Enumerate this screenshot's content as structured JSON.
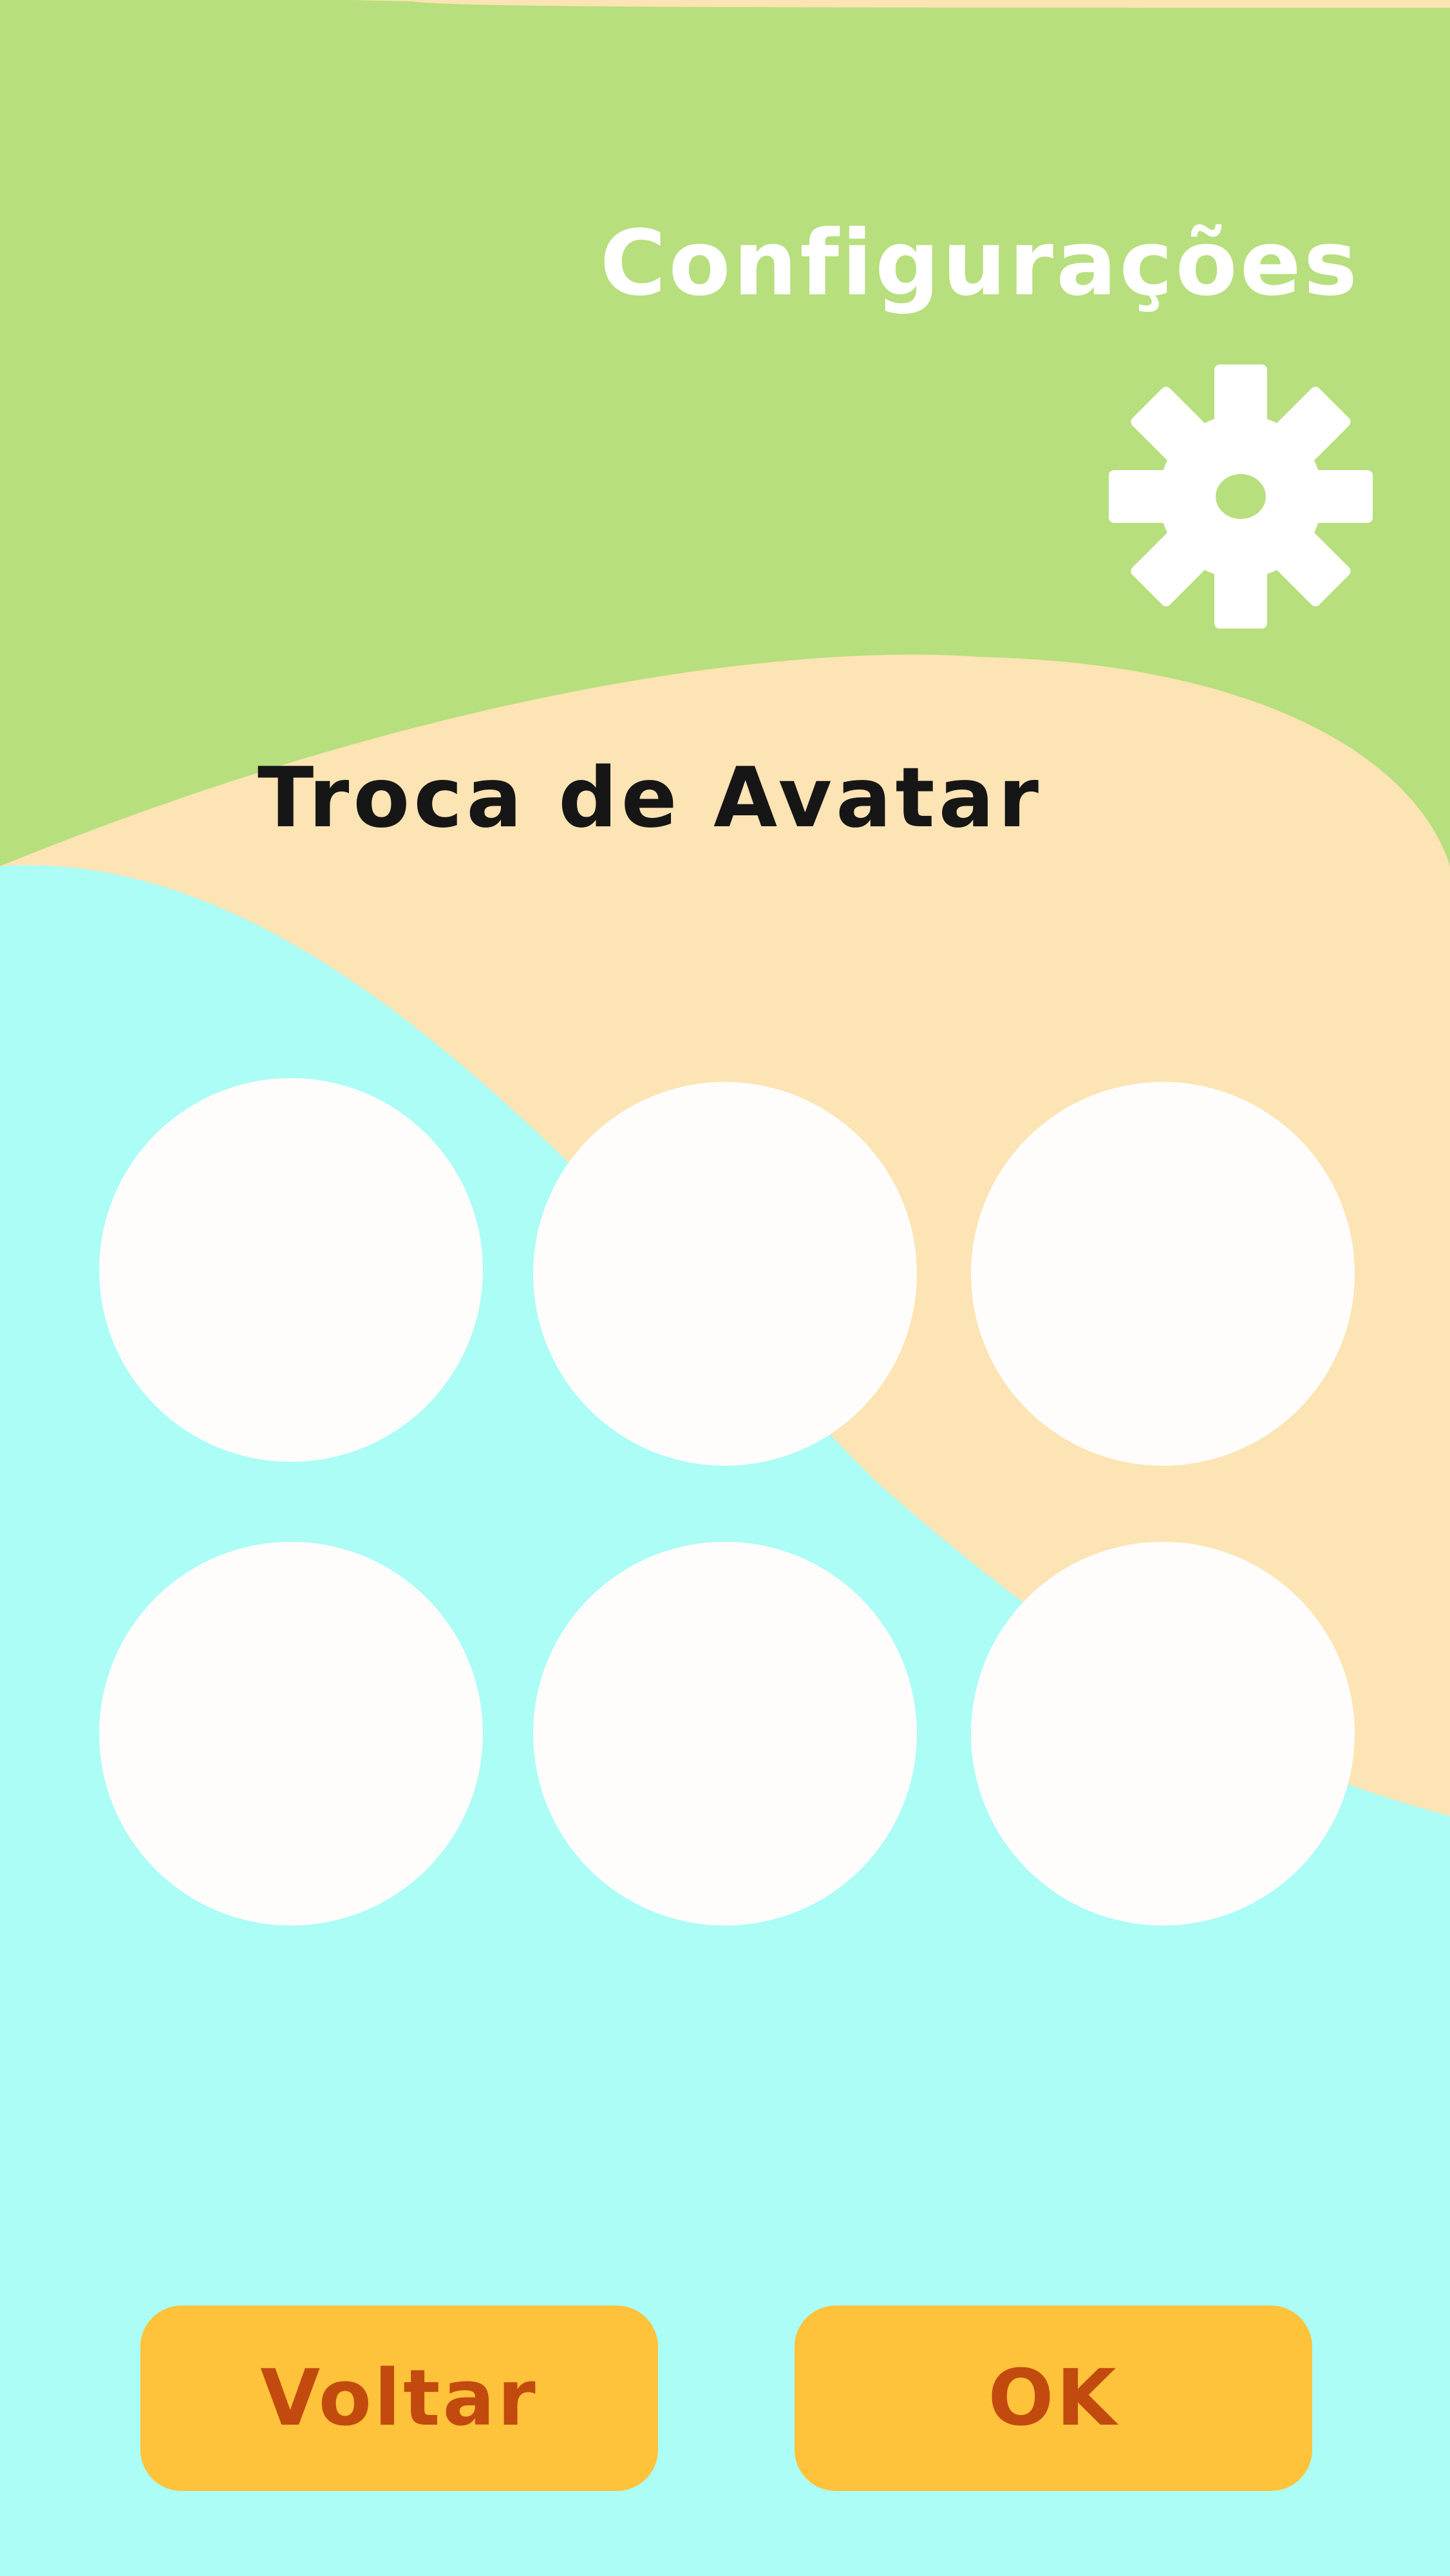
{
  "screen": {
    "title": "Configurações",
    "subtitle": "Troca de Avatar",
    "icon": "gear-icon"
  },
  "avatars": [
    {
      "slot": 1
    },
    {
      "slot": 2
    },
    {
      "slot": 3
    },
    {
      "slot": 4
    },
    {
      "slot": 5
    },
    {
      "slot": 6
    }
  ],
  "buttons": {
    "back_label": "Voltar",
    "ok_label": "OK"
  },
  "colors": {
    "header_green": "#b7df7d",
    "band_peach": "#fde4b4",
    "body_cyan": "#abfdf6",
    "avatar_white": "#fefdfb",
    "button_yellow": "#fec23b",
    "button_text": "#c34a0e",
    "title_text": "#ffffff",
    "subtitle_text": "#161616"
  }
}
